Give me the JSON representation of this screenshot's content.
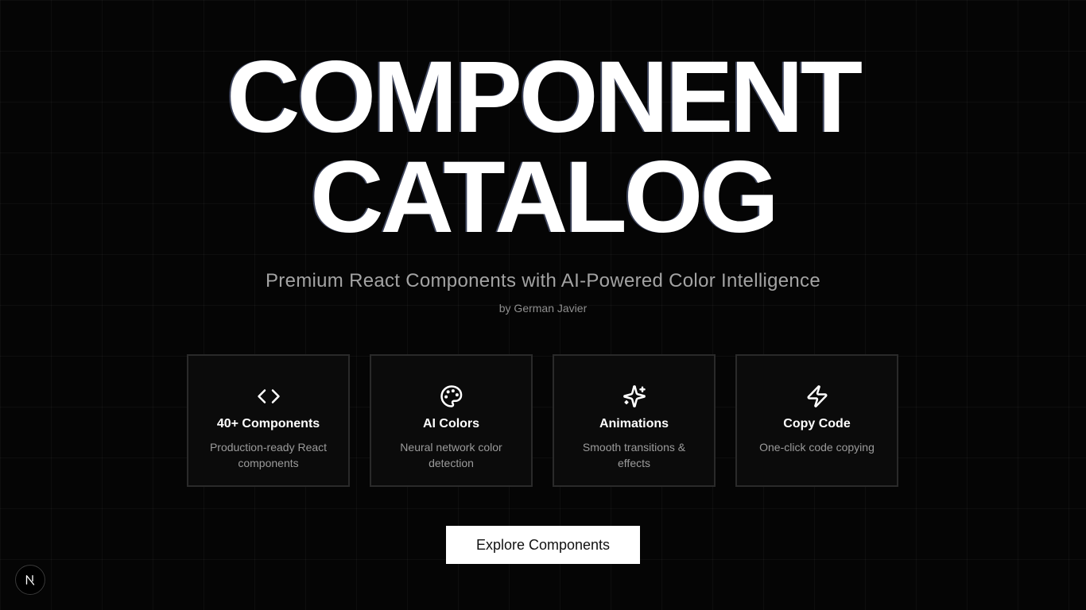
{
  "hero": {
    "title_line1": "COMPONENT",
    "title_line2": "CATALOG",
    "subtitle": "Premium React Components with AI-Powered Color Intelligence",
    "author": "by German Javier"
  },
  "features": [
    {
      "icon": "code-icon",
      "title": "40+ Components",
      "desc": "Production-ready React components"
    },
    {
      "icon": "palette-icon",
      "title": "AI Colors",
      "desc": "Neural network color detection"
    },
    {
      "icon": "sparkles-icon",
      "title": "Animations",
      "desc": "Smooth transitions & effects"
    },
    {
      "icon": "zap-icon",
      "title": "Copy Code",
      "desc": "One-click code copying"
    }
  ],
  "cta": {
    "label": "Explore Components"
  },
  "badge": {
    "icon": "nextjs-logo-icon",
    "letter": "N"
  },
  "colors": {
    "background": "#050505",
    "card_background": "#0b0b0b",
    "card_border": "#2a2a2a",
    "text_primary": "#ffffff",
    "text_muted": "#a3a3a3",
    "button_bg": "#ffffff",
    "button_text": "#111111"
  }
}
